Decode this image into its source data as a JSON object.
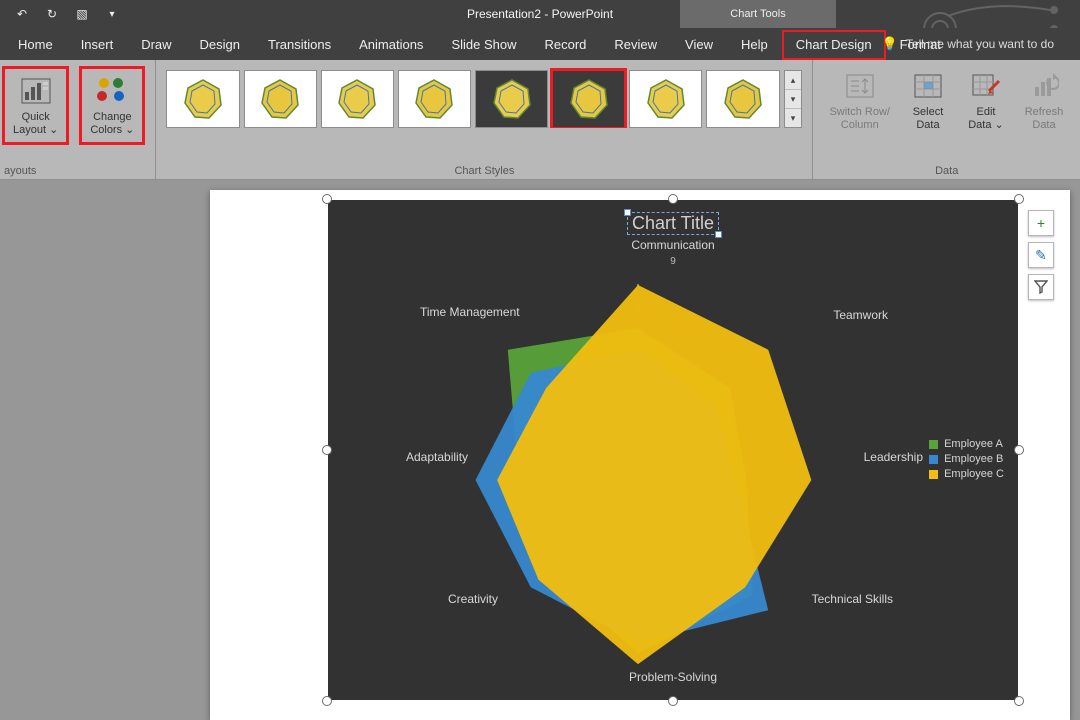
{
  "titlebar": {
    "title": "Presentation2  -  PowerPoint",
    "context_tab": "Chart Tools"
  },
  "tabs": {
    "items": [
      "Home",
      "Insert",
      "Draw",
      "Design",
      "Transitions",
      "Animations",
      "Slide Show",
      "Record",
      "Review",
      "View",
      "Help",
      "Chart Design",
      "Format"
    ],
    "active": "Chart Design",
    "tellme_placeholder": "Tell me what you want to do"
  },
  "ribbon": {
    "layouts": {
      "quick_layout": "Quick\nLayout ⌄",
      "group_label": "ayouts"
    },
    "colors": {
      "change_colors": "Change\nColors ⌄"
    },
    "styles": {
      "group_label": "Chart Styles",
      "selected_index": 5
    },
    "data": {
      "switch": "Switch Row/\nColumn",
      "select": "Select\nData",
      "edit": "Edit\nData ⌄",
      "refresh": "Refresh\nData",
      "group_label": "Data"
    }
  },
  "chart_ui": {
    "title": "Chart Title",
    "legend": [
      "Employee A",
      "Employee B",
      "Employee C"
    ],
    "legend_colors": [
      "#58A33A",
      "#3788CF",
      "#F2BE10"
    ],
    "scale_label": "9",
    "float_plus": "+",
    "float_brush": "✎",
    "float_funnel": "⏷"
  },
  "chart_data": {
    "type": "area",
    "subtype": "radar_filled",
    "title": "Chart Title",
    "categories": [
      "Communication",
      "Teamwork",
      "Leadership",
      "Technical Skills",
      "Problem-Solving",
      "Creativity",
      "Adaptability",
      "Time Management"
    ],
    "radial_max": 9,
    "series": [
      {
        "name": "Employee A",
        "color": "#58A33A",
        "values": [
          7.0,
          6.0,
          5.0,
          7.5,
          8.0,
          6.0,
          5.5,
          8.5
        ]
      },
      {
        "name": "Employee B",
        "color": "#3788CF",
        "values": [
          6.0,
          5.0,
          4.5,
          8.5,
          7.5,
          7.0,
          7.5,
          7.0
        ]
      },
      {
        "name": "Employee C",
        "color": "#F2BE10",
        "values": [
          9.0,
          8.5,
          8.0,
          7.0,
          8.5,
          6.5,
          6.5,
          6.0
        ]
      }
    ]
  }
}
